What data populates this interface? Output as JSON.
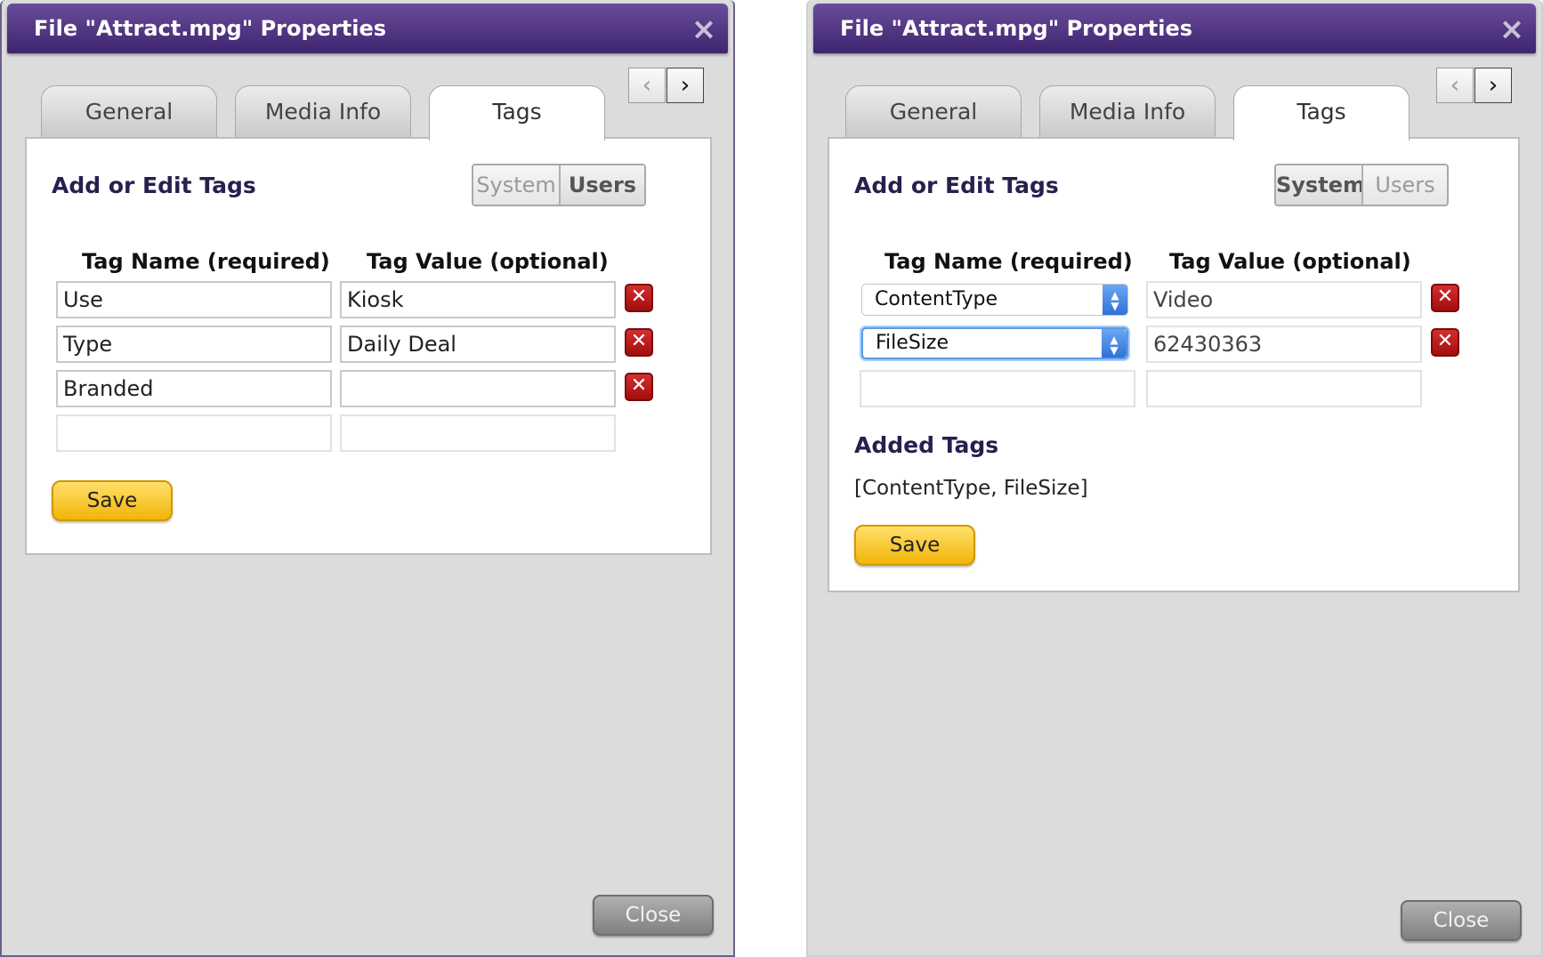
{
  "left": {
    "title": "File \"Attract.mpg\" Properties",
    "close_glyph": "×",
    "tabs": [
      "General",
      "Media Info",
      "Tags"
    ],
    "active_tab": "Tags",
    "nav": {
      "prev": "‹",
      "next": "›"
    },
    "heading": "Add or Edit Tags",
    "toggle": {
      "system": "System",
      "users": "Users",
      "selected": "Users"
    },
    "col_name": "Tag Name (required)",
    "col_value": "Tag Value (optional)",
    "rows": [
      {
        "name": "Use",
        "value": "Kiosk"
      },
      {
        "name": "Type",
        "value": "Daily Deal"
      },
      {
        "name": "Branded",
        "value": ""
      },
      {
        "name": "",
        "value": ""
      }
    ],
    "delete_glyph": "✕",
    "save_label": "Save",
    "close_label": "Close"
  },
  "right": {
    "title": "File \"Attract.mpg\" Properties",
    "close_glyph": "×",
    "tabs": [
      "General",
      "Media Info",
      "Tags"
    ],
    "active_tab": "Tags",
    "nav": {
      "prev": "‹",
      "next": "›"
    },
    "heading": "Add or Edit Tags",
    "toggle": {
      "system": "System",
      "users": "Users",
      "selected": "System"
    },
    "col_name": "Tag Name (required)",
    "col_value": "Tag Value (optional)",
    "rows": [
      {
        "name": "ContentType",
        "value": "Video"
      },
      {
        "name": "FileSize",
        "value": "62430363"
      },
      {
        "name": "",
        "value": ""
      }
    ],
    "delete_glyph": "✕",
    "added_heading": "Added Tags",
    "added_list": "[ContentType, FileSize]",
    "save_label": "Save",
    "close_label": "Close"
  },
  "colors": {
    "titlebar": "#4b2f80",
    "save": "#f7c51e",
    "delete": "#b81818",
    "focus": "#5a9be6"
  }
}
